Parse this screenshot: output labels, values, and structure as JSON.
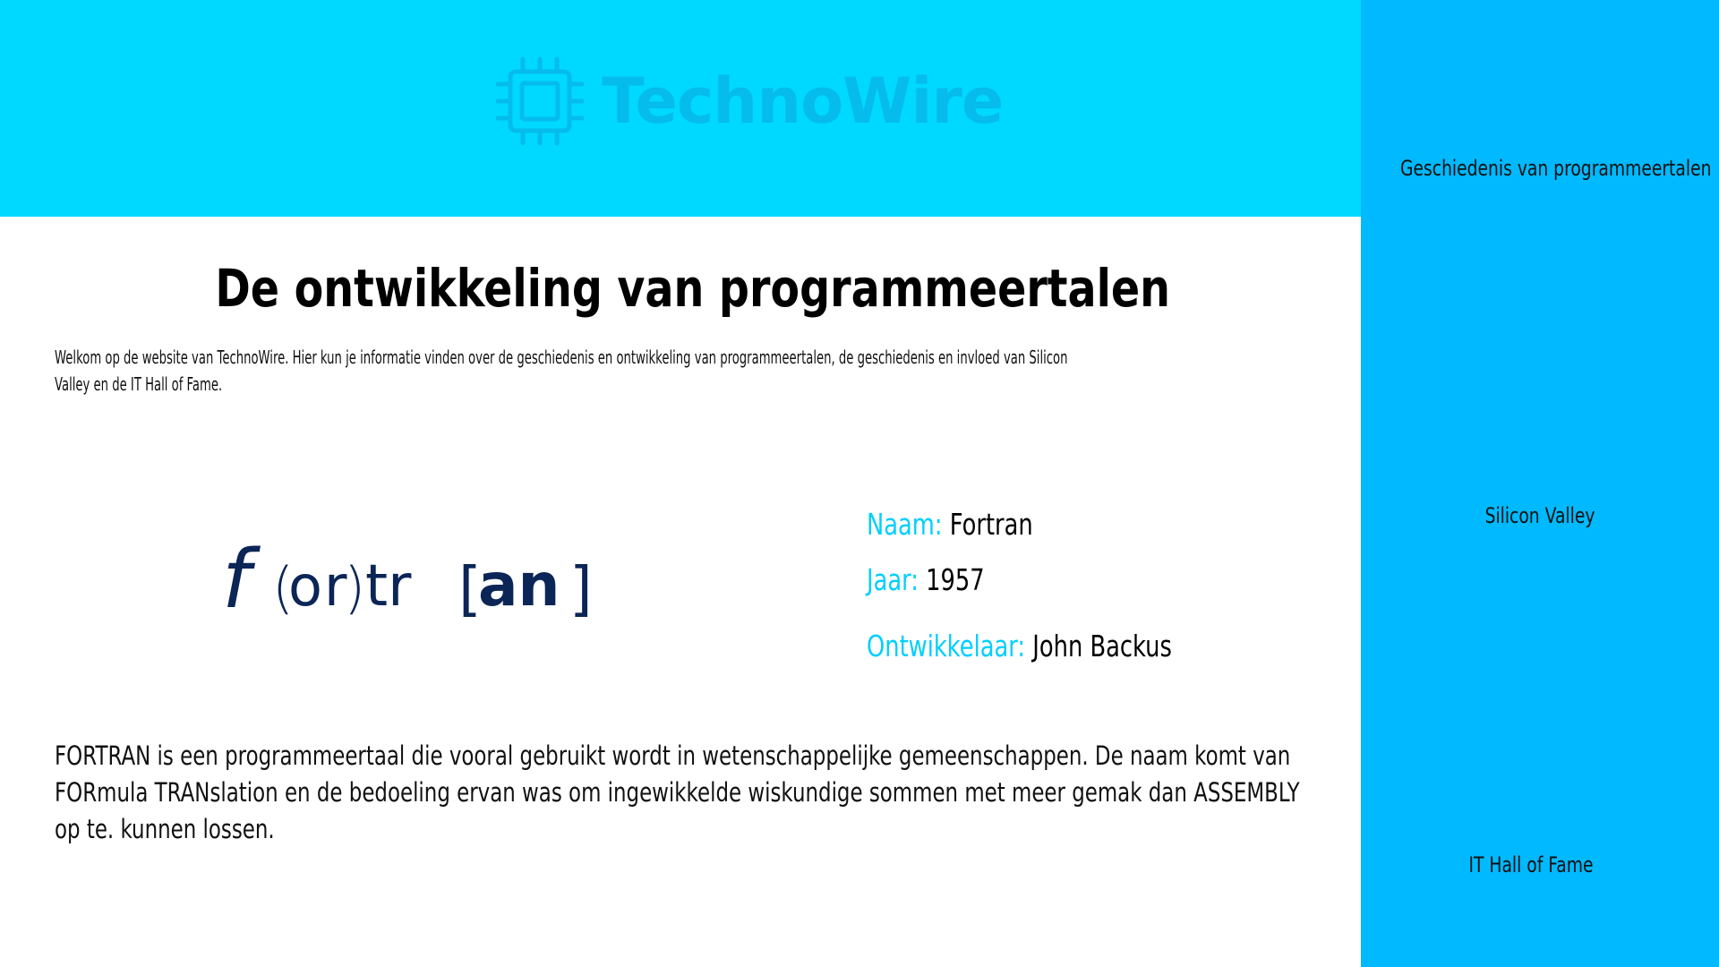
{
  "header": {
    "logo_text": "TechnoWire",
    "logo_icon": "chip-icon",
    "background": "#00d9ff"
  },
  "sidebar": {
    "background": "#00b9ff",
    "items": [
      {
        "label": "Geschiedenis van programmeertalen"
      },
      {
        "label": "Silicon Valley"
      },
      {
        "label": "IT Hall of Fame"
      }
    ]
  },
  "main": {
    "title": "De ontwikkeling van programmeertalen",
    "intro": "Welkom op de website van TechnoWire. Hier kun je informatie vinden over de geschiedenis en ontwikkeling van programmeertalen, de geschiedenis en invloed van Silicon Valley en de IT Hall of Fame.",
    "language_logo": {
      "parts": [
        "f",
        "(",
        "o",
        "r",
        ")",
        "tr",
        "[",
        "an",
        "]"
      ],
      "color": "#0b2557"
    },
    "facts": {
      "key_color": "#00cfff",
      "name_key": "Naam:",
      "name_value": "Fortran",
      "year_key": "Jaar:",
      "year_value": "1957",
      "developer_key": "Ontwikkelaar:",
      "developer_value": "John Backus"
    },
    "description": "FORTRAN is een programmeertaal die vooral gebruikt wordt in wetenschappelijke gemeenschappen. De naam komt van FORmula TRANslation en de bedoeling ervan was om ingewikkelde wiskundige sommen met meer gemak dan ASSEMBLY op te. kunnen lossen."
  }
}
